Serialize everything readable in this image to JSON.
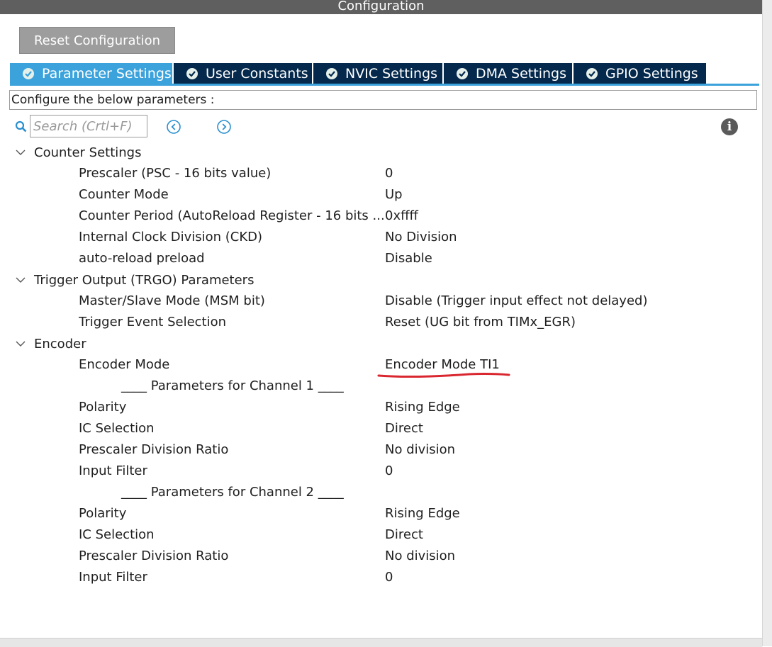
{
  "window": {
    "title": "Configuration"
  },
  "toolbar": {
    "reset_label": "Reset Configuration"
  },
  "tabs": [
    {
      "label": "Parameter Settings",
      "active": true
    },
    {
      "label": "User Constants",
      "active": false
    },
    {
      "label": "NVIC Settings",
      "active": false
    },
    {
      "label": "DMA Settings",
      "active": false
    },
    {
      "label": "GPIO Settings",
      "active": false
    }
  ],
  "description": "Configure the below parameters :",
  "search": {
    "placeholder": "Search (Crtl+F)",
    "value": ""
  },
  "icons": {
    "search": "search-icon",
    "prev": "chevron-left-circle-icon",
    "next": "chevron-right-circle-icon",
    "info": "info-icon",
    "tab_status": "check-circle-icon",
    "group_toggle": "chevron-down-icon"
  },
  "colors": {
    "titlebar": "#5f5f5f",
    "tab_active": "#3ba2db",
    "tab_inactive": "#04294c",
    "reset_button": "#9d9d9d",
    "annotation": "#d9262f"
  },
  "sections": [
    {
      "title": "Counter Settings",
      "params": [
        {
          "label": "Prescaler (PSC - 16 bits value)",
          "value": "0"
        },
        {
          "label": "Counter Mode",
          "value": "Up"
        },
        {
          "label": "Counter Period (AutoReload Register - 16 bits ...",
          "value": "0xffff"
        },
        {
          "label": "Internal Clock Division (CKD)",
          "value": "No Division"
        },
        {
          "label": "auto-reload preload",
          "value": "Disable"
        }
      ]
    },
    {
      "title": "Trigger Output (TRGO) Parameters",
      "params": [
        {
          "label": "Master/Slave Mode (MSM bit)",
          "value": "Disable (Trigger input effect not delayed)"
        },
        {
          "label": "Trigger Event Selection",
          "value": "Reset (UG bit from TIMx_EGR)"
        }
      ]
    },
    {
      "title": "Encoder",
      "encoder_mode": {
        "label": "Encoder Mode",
        "value": "Encoder Mode TI1"
      },
      "channel1": {
        "heading": "____ Parameters for Channel 1 ____",
        "params": [
          {
            "label": "Polarity",
            "value": "Rising Edge"
          },
          {
            "label": "IC Selection",
            "value": "Direct"
          },
          {
            "label": "Prescaler Division Ratio",
            "value": "No division"
          },
          {
            "label": "Input Filter",
            "value": "0"
          }
        ]
      },
      "channel2": {
        "heading": "____ Parameters for Channel 2 ____",
        "params": [
          {
            "label": "Polarity",
            "value": "Rising Edge"
          },
          {
            "label": "IC Selection",
            "value": "Direct"
          },
          {
            "label": "Prescaler Division Ratio",
            "value": "No division"
          },
          {
            "label": "Input Filter",
            "value": "0"
          }
        ]
      }
    }
  ]
}
